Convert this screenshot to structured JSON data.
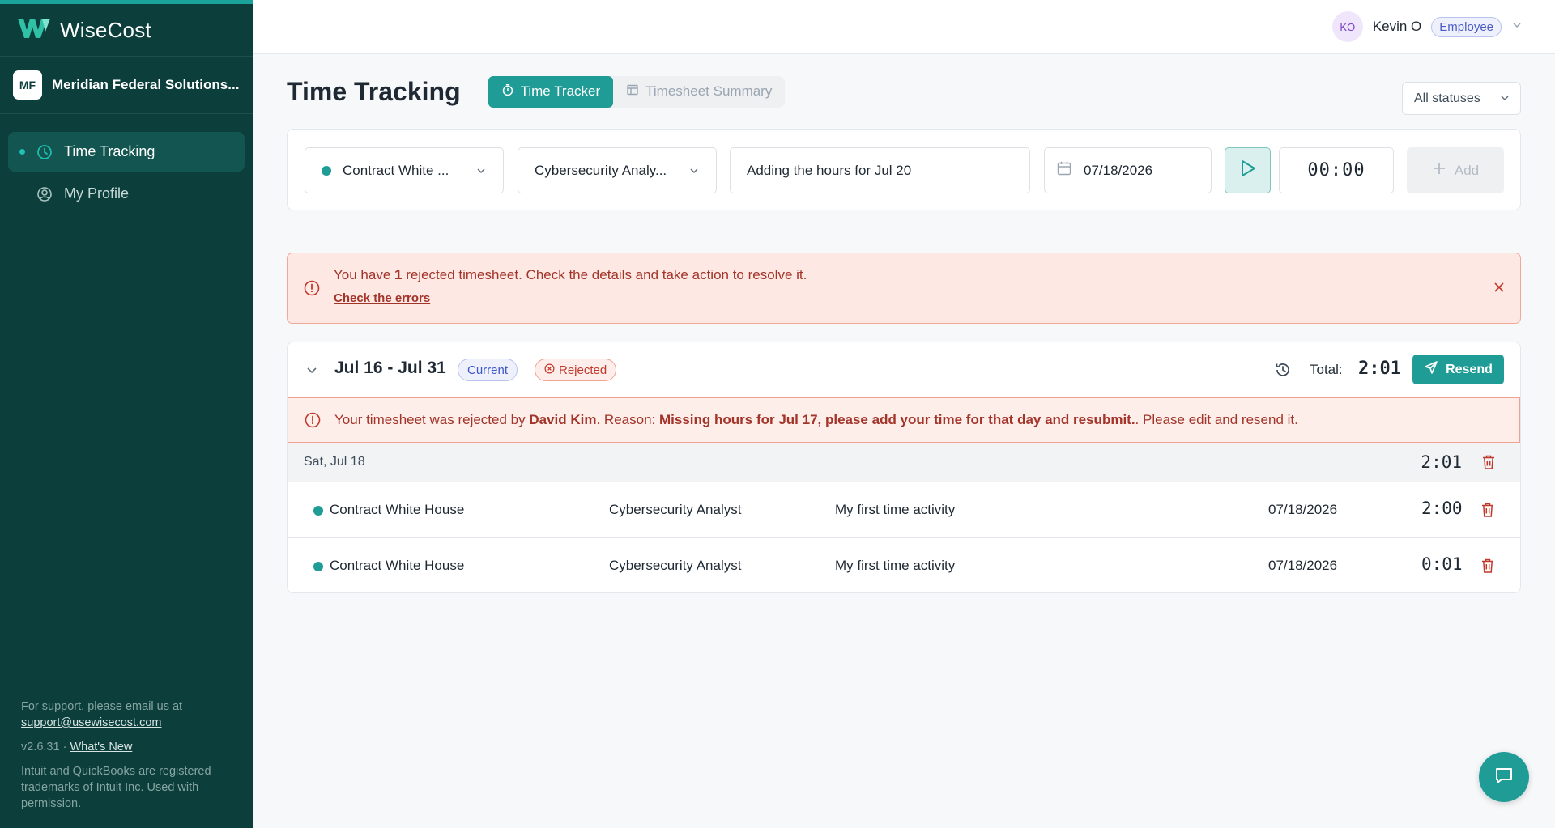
{
  "brand": {
    "name": "WiseCost"
  },
  "org": {
    "initials": "MF",
    "name": "Meridian Federal Solutions..."
  },
  "nav": [
    {
      "label": "Time Tracking",
      "active": true
    },
    {
      "label": "My Profile",
      "active": false
    }
  ],
  "footer": {
    "support_text": "For support, please email us at",
    "support_email": "support@usewisecost.com",
    "version": "v2.6.31 · ",
    "whats_new": "What's New",
    "trademark": "Intuit and QuickBooks are registered trademarks of Intuit Inc. Used with permission."
  },
  "user": {
    "initials": "KO",
    "name": "Kevin O",
    "role": "Employee"
  },
  "page": {
    "title": "Time Tracking",
    "tab_tracker": "Time Tracker",
    "tab_summary": "Timesheet Summary",
    "status_filter": "All statuses"
  },
  "tracker": {
    "project": "Contract White ...",
    "role": "Cybersecurity Analy...",
    "description": "Adding the hours for Jul 20",
    "date": "07/18/2026",
    "timer": "00:00",
    "add_label": "Add"
  },
  "alert": {
    "prefix": "You have ",
    "count": "1",
    "suffix": " rejected timesheet. Check the details and take action to resolve it.",
    "link": "Check the errors"
  },
  "timesheet": {
    "period": "Jul 16 - Jul 31",
    "badge_current": "Current",
    "badge_status": "Rejected",
    "total_label": "Total:",
    "total_value": "2:01",
    "resend_label": "Resend",
    "reject_prefix": "Your timesheet was rejected by ",
    "reject_by": "David Kim",
    "reject_mid": ". Reason: ",
    "reject_reason": "Missing hours for Jul 17, please add your time for that day and resubmit.",
    "reject_suffix": ". Please edit and resend it.",
    "day_label": "Sat, Jul 18",
    "day_total": "2:01",
    "entries": [
      {
        "project": "Contract White House",
        "role": "Cybersecurity Analyst",
        "description": "My first time activity",
        "date": "07/18/2026",
        "duration": "2:00"
      },
      {
        "project": "Contract White House",
        "role": "Cybersecurity Analyst",
        "description": "My first time activity",
        "date": "07/18/2026",
        "duration": "0:01"
      }
    ]
  },
  "colors": {
    "accent": "#1f9c96",
    "sidebar": "#0c3f3c",
    "danger": "#c0392b"
  }
}
